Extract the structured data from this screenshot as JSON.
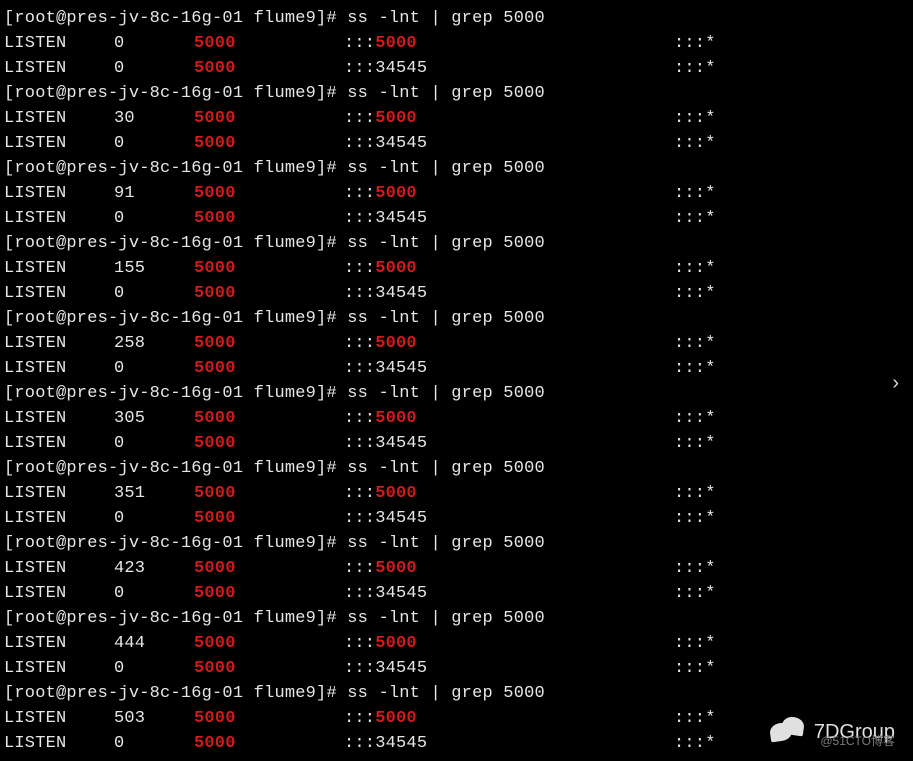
{
  "prompt": {
    "open": "[",
    "user": "root",
    "at": "@",
    "host": "pres-jv-8c-16g-01",
    "sep": " ",
    "cwd": "flume9",
    "close": "]",
    "hash": "# "
  },
  "command": {
    "cmd1": "ss -lnt",
    "pipe": " | ",
    "cmd2": "grep ",
    "pattern": "5000"
  },
  "listen_label": "LISTEN",
  "local_prefix": ":::",
  "peer": ":::*",
  "port_hit": "5000",
  "port_other": "34545",
  "runs": [
    {
      "rows": [
        {
          "recv": "0",
          "match": true
        },
        {
          "recv": "0",
          "match": false
        }
      ]
    },
    {
      "rows": [
        {
          "recv": "30",
          "match": true
        },
        {
          "recv": "0",
          "match": false
        }
      ]
    },
    {
      "rows": [
        {
          "recv": "91",
          "match": true
        },
        {
          "recv": "0",
          "match": false
        }
      ]
    },
    {
      "rows": [
        {
          "recv": "155",
          "match": true
        },
        {
          "recv": "0",
          "match": false
        }
      ]
    },
    {
      "rows": [
        {
          "recv": "258",
          "match": true
        },
        {
          "recv": "0",
          "match": false
        }
      ]
    },
    {
      "rows": [
        {
          "recv": "305",
          "match": true
        },
        {
          "recv": "0",
          "match": false
        }
      ]
    },
    {
      "rows": [
        {
          "recv": "351",
          "match": true
        },
        {
          "recv": "0",
          "match": false
        }
      ]
    },
    {
      "rows": [
        {
          "recv": "423",
          "match": true
        },
        {
          "recv": "0",
          "match": false
        }
      ]
    },
    {
      "rows": [
        {
          "recv": "444",
          "match": true
        },
        {
          "recv": "0",
          "match": false
        }
      ]
    },
    {
      "rows": [
        {
          "recv": "503",
          "match": true
        },
        {
          "recv": "0",
          "match": false
        }
      ]
    }
  ],
  "watermark": {
    "brand": "7DGroup",
    "sub": "@51CTO博客"
  },
  "chevron": "›"
}
